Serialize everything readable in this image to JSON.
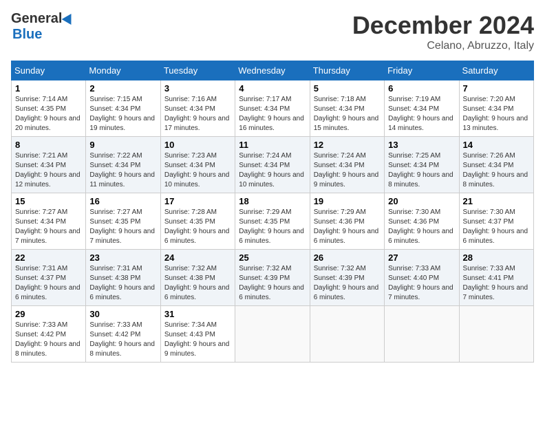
{
  "header": {
    "logo_general": "General",
    "logo_blue": "Blue",
    "month": "December 2024",
    "location": "Celano, Abruzzo, Italy"
  },
  "weekdays": [
    "Sunday",
    "Monday",
    "Tuesday",
    "Wednesday",
    "Thursday",
    "Friday",
    "Saturday"
  ],
  "weeks": [
    [
      {
        "day": "1",
        "info": "Sunrise: 7:14 AM\nSunset: 4:35 PM\nDaylight: 9 hours and 20 minutes."
      },
      {
        "day": "2",
        "info": "Sunrise: 7:15 AM\nSunset: 4:34 PM\nDaylight: 9 hours and 19 minutes."
      },
      {
        "day": "3",
        "info": "Sunrise: 7:16 AM\nSunset: 4:34 PM\nDaylight: 9 hours and 17 minutes."
      },
      {
        "day": "4",
        "info": "Sunrise: 7:17 AM\nSunset: 4:34 PM\nDaylight: 9 hours and 16 minutes."
      },
      {
        "day": "5",
        "info": "Sunrise: 7:18 AM\nSunset: 4:34 PM\nDaylight: 9 hours and 15 minutes."
      },
      {
        "day": "6",
        "info": "Sunrise: 7:19 AM\nSunset: 4:34 PM\nDaylight: 9 hours and 14 minutes."
      },
      {
        "day": "7",
        "info": "Sunrise: 7:20 AM\nSunset: 4:34 PM\nDaylight: 9 hours and 13 minutes."
      }
    ],
    [
      {
        "day": "8",
        "info": "Sunrise: 7:21 AM\nSunset: 4:34 PM\nDaylight: 9 hours and 12 minutes."
      },
      {
        "day": "9",
        "info": "Sunrise: 7:22 AM\nSunset: 4:34 PM\nDaylight: 9 hours and 11 minutes."
      },
      {
        "day": "10",
        "info": "Sunrise: 7:23 AM\nSunset: 4:34 PM\nDaylight: 9 hours and 10 minutes."
      },
      {
        "day": "11",
        "info": "Sunrise: 7:24 AM\nSunset: 4:34 PM\nDaylight: 9 hours and 10 minutes."
      },
      {
        "day": "12",
        "info": "Sunrise: 7:24 AM\nSunset: 4:34 PM\nDaylight: 9 hours and 9 minutes."
      },
      {
        "day": "13",
        "info": "Sunrise: 7:25 AM\nSunset: 4:34 PM\nDaylight: 9 hours and 8 minutes."
      },
      {
        "day": "14",
        "info": "Sunrise: 7:26 AM\nSunset: 4:34 PM\nDaylight: 9 hours and 8 minutes."
      }
    ],
    [
      {
        "day": "15",
        "info": "Sunrise: 7:27 AM\nSunset: 4:34 PM\nDaylight: 9 hours and 7 minutes."
      },
      {
        "day": "16",
        "info": "Sunrise: 7:27 AM\nSunset: 4:35 PM\nDaylight: 9 hours and 7 minutes."
      },
      {
        "day": "17",
        "info": "Sunrise: 7:28 AM\nSunset: 4:35 PM\nDaylight: 9 hours and 6 minutes."
      },
      {
        "day": "18",
        "info": "Sunrise: 7:29 AM\nSunset: 4:35 PM\nDaylight: 9 hours and 6 minutes."
      },
      {
        "day": "19",
        "info": "Sunrise: 7:29 AM\nSunset: 4:36 PM\nDaylight: 9 hours and 6 minutes."
      },
      {
        "day": "20",
        "info": "Sunrise: 7:30 AM\nSunset: 4:36 PM\nDaylight: 9 hours and 6 minutes."
      },
      {
        "day": "21",
        "info": "Sunrise: 7:30 AM\nSunset: 4:37 PM\nDaylight: 9 hours and 6 minutes."
      }
    ],
    [
      {
        "day": "22",
        "info": "Sunrise: 7:31 AM\nSunset: 4:37 PM\nDaylight: 9 hours and 6 minutes."
      },
      {
        "day": "23",
        "info": "Sunrise: 7:31 AM\nSunset: 4:38 PM\nDaylight: 9 hours and 6 minutes."
      },
      {
        "day": "24",
        "info": "Sunrise: 7:32 AM\nSunset: 4:38 PM\nDaylight: 9 hours and 6 minutes."
      },
      {
        "day": "25",
        "info": "Sunrise: 7:32 AM\nSunset: 4:39 PM\nDaylight: 9 hours and 6 minutes."
      },
      {
        "day": "26",
        "info": "Sunrise: 7:32 AM\nSunset: 4:39 PM\nDaylight: 9 hours and 6 minutes."
      },
      {
        "day": "27",
        "info": "Sunrise: 7:33 AM\nSunset: 4:40 PM\nDaylight: 9 hours and 7 minutes."
      },
      {
        "day": "28",
        "info": "Sunrise: 7:33 AM\nSunset: 4:41 PM\nDaylight: 9 hours and 7 minutes."
      }
    ],
    [
      {
        "day": "29",
        "info": "Sunrise: 7:33 AM\nSunset: 4:42 PM\nDaylight: 9 hours and 8 minutes."
      },
      {
        "day": "30",
        "info": "Sunrise: 7:33 AM\nSunset: 4:42 PM\nDaylight: 9 hours and 8 minutes."
      },
      {
        "day": "31",
        "info": "Sunrise: 7:34 AM\nSunset: 4:43 PM\nDaylight: 9 hours and 9 minutes."
      },
      null,
      null,
      null,
      null
    ]
  ]
}
